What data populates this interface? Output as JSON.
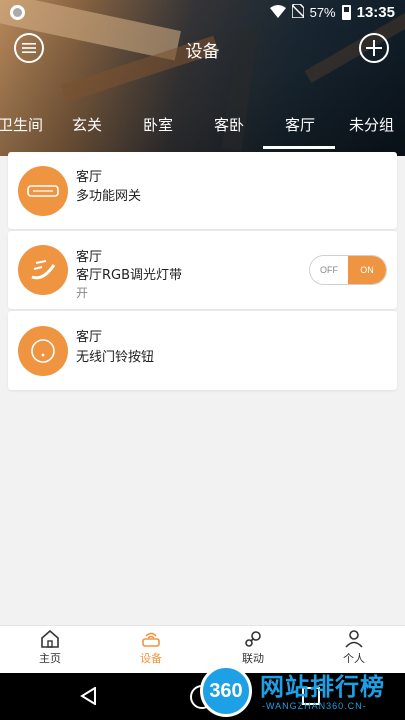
{
  "status_bar": {
    "battery": "57%",
    "time": "13:35"
  },
  "header": {
    "title": "设备"
  },
  "tabs": [
    {
      "label": "卫生间"
    },
    {
      "label": "玄关"
    },
    {
      "label": "卧室"
    },
    {
      "label": "客卧"
    },
    {
      "label": "客厅",
      "active": true
    },
    {
      "label": "未分组"
    }
  ],
  "devices": [
    {
      "room": "客厅",
      "name": "多功能网关",
      "icon": "gateway-icon"
    },
    {
      "room": "客厅",
      "name": "客厅RGB调光灯带",
      "state": "开",
      "icon": "led-strip-icon",
      "toggle": {
        "off_label": "OFF",
        "on_label": "ON",
        "value": "on"
      }
    },
    {
      "room": "客厅",
      "name": "无线门铃按钮",
      "icon": "doorbell-button-icon"
    }
  ],
  "bottom_nav": [
    {
      "label": "主页",
      "icon": "home-icon"
    },
    {
      "label": "设备",
      "icon": "router-icon",
      "active": true
    },
    {
      "label": "联动",
      "icon": "link-icon"
    },
    {
      "label": "个人",
      "icon": "person-icon"
    }
  ],
  "watermark": {
    "logo": "360",
    "text": "网站排行榜",
    "sub": "-WANGZHAN360.CN-"
  },
  "colors": {
    "accent": "#ef9542",
    "watermark": "#1da0e6"
  }
}
